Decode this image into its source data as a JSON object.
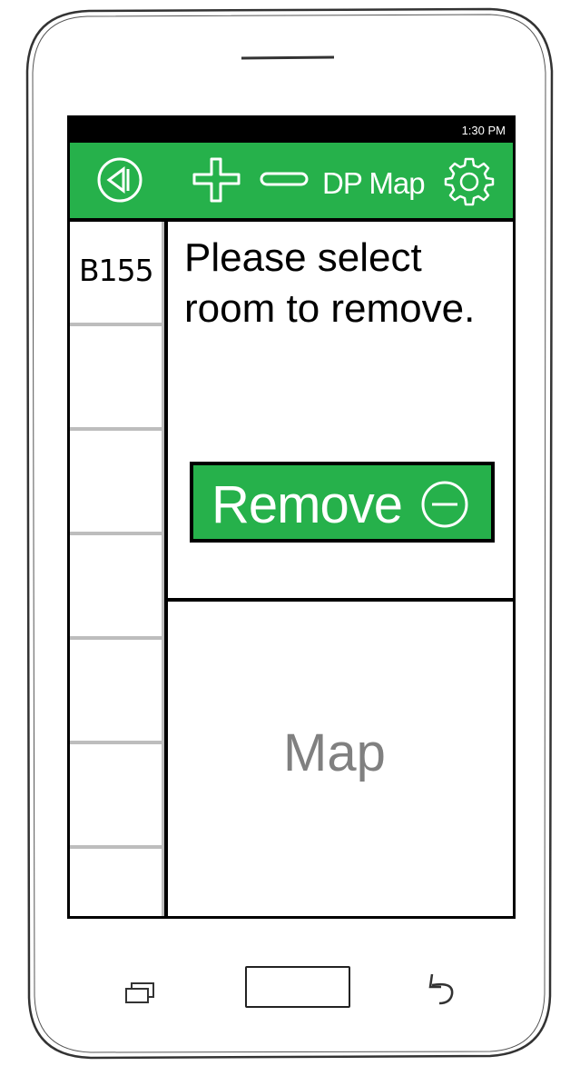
{
  "status_bar": {
    "time": "1:30 PM"
  },
  "app_bar": {
    "title": "DP Map",
    "icons": [
      "back-icon",
      "plus-icon",
      "minus-icon",
      "gear-icon"
    ]
  },
  "sidebar": {
    "items": [
      {
        "label": "B155"
      },
      {
        "label": ""
      },
      {
        "label": ""
      },
      {
        "label": ""
      },
      {
        "label": ""
      },
      {
        "label": ""
      },
      {
        "label": ""
      }
    ]
  },
  "main": {
    "prompt": "Please select room to remove.",
    "remove_button": {
      "label": "Remove",
      "icon": "minus-circle-icon"
    }
  },
  "map_panel": {
    "label": "Map"
  },
  "nav_bar": {
    "icons": [
      "recent-apps-icon",
      "home-button",
      "back-arrow-icon"
    ]
  },
  "colors": {
    "accent": "#26b14b",
    "frame": "#000000",
    "divider": "#bdbdbd",
    "map_text": "#808080"
  }
}
